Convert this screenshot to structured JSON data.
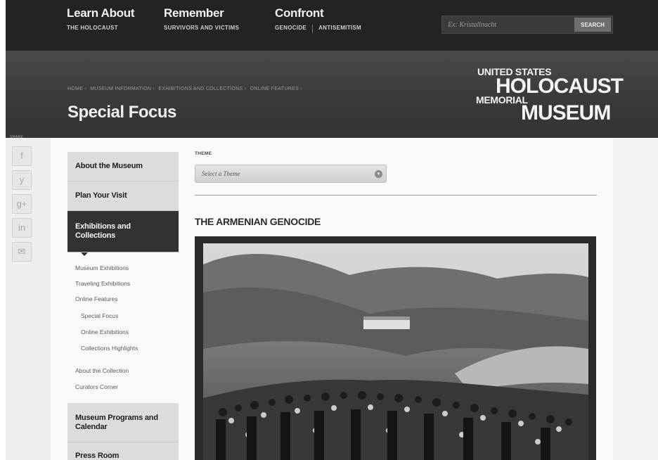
{
  "nav": {
    "groups": [
      {
        "title": "Learn About",
        "subs": [
          "THE HOLOCAUST"
        ]
      },
      {
        "title": "Remember",
        "subs": [
          "SURVIVORS AND VICTIMS"
        ]
      },
      {
        "title": "Confront",
        "subs": [
          "GENOCIDE",
          "ANTISEMITISM"
        ]
      }
    ],
    "search": {
      "placeholder": "Ex: Kristallnacht",
      "button_label": "SEARCH"
    }
  },
  "hero": {
    "breadcrumb": [
      "HOME ›",
      "MUSEUM INFORMATION ›",
      "EXHIBITIONS AND COLLECTIONS ›",
      "ONLINE FEATURES ›"
    ],
    "title": "Special Focus",
    "logo": {
      "line1": "UNITED STATES",
      "line2": "HOLOCAUST",
      "line3": "MEMORIAL",
      "line4": "MUSEUM"
    }
  },
  "share": {
    "label": "SHARE",
    "buttons": [
      {
        "icon": "facebook-icon",
        "glyph": "f"
      },
      {
        "icon": "twitter-icon",
        "glyph": "y"
      },
      {
        "icon": "googleplus-icon",
        "glyph": "g+"
      },
      {
        "icon": "linkedin-icon",
        "glyph": "in"
      },
      {
        "icon": "email-icon",
        "glyph": "✉"
      }
    ]
  },
  "sidebar": {
    "items": [
      {
        "label": "About the Museum"
      },
      {
        "label": "Plan Your Visit"
      },
      {
        "label": "Exhibitions and Collections"
      },
      {
        "label": "Museum Programs and Calendar"
      },
      {
        "label": "Press Room"
      }
    ],
    "subitems": [
      "Museum Exhibitions",
      "Traveling Exhibitions",
      "Online Features",
      "Special Focus",
      "Online Exhibitions",
      "Collections Highlights",
      "About the Collection",
      "Curators Corner"
    ]
  },
  "main": {
    "theme_label": "THEME",
    "theme_select": "Select a Theme",
    "section_title": "THE ARMENIAN GENOCIDE"
  },
  "colors": {
    "nav_bg": "#232323",
    "hero_bg": "#3a3a3a",
    "active_item_bg": "#323232",
    "sidebar_item_bg": "#dcdcdc"
  }
}
